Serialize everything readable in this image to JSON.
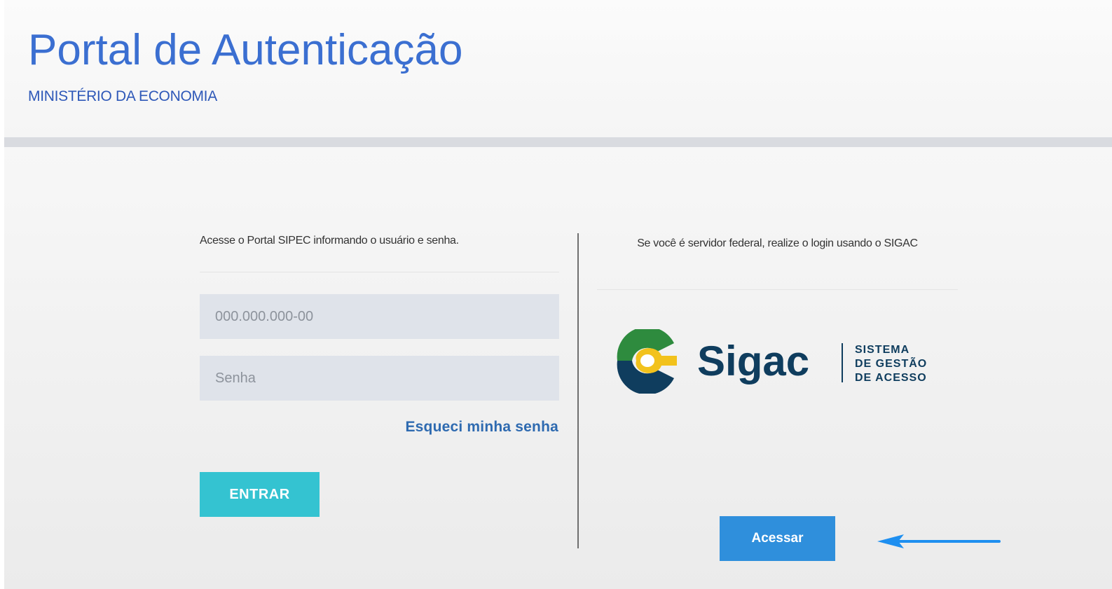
{
  "header": {
    "title": "Portal de Autenticação",
    "subtitle": "MINISTÉRIO DA ECONOMIA"
  },
  "left_panel": {
    "intro": "Acesse o Portal SIPEC informando o usuário e senha.",
    "cpf_placeholder": "000.000.000-00",
    "password_placeholder": "Senha",
    "forgot_password": "Esqueci minha senha",
    "submit_label": "ENTRAR"
  },
  "right_panel": {
    "intro": "Se você é servidor federal, realize o login usando o SIGAC",
    "logo": {
      "wordmark": "Sigac",
      "tagline_1": "SISTEMA",
      "tagline_2": "DE GESTÃO",
      "tagline_3": "DE ACESSO",
      "icon": "sigac-logo-icon"
    },
    "access_label": "Acessar",
    "annotation_icon": "arrow-left-icon"
  },
  "colors": {
    "title": "#3b6fd1",
    "entrar_button": "#34c3d1",
    "acessar_button": "#2f8fdc",
    "link": "#2e6ab0",
    "input_bg": "#dfe3ea",
    "logo_green": "#2e8b3e",
    "logo_navy": "#0f3d5e",
    "logo_yellow": "#f2c21c",
    "annotation_arrow": "#1e8ff0"
  }
}
